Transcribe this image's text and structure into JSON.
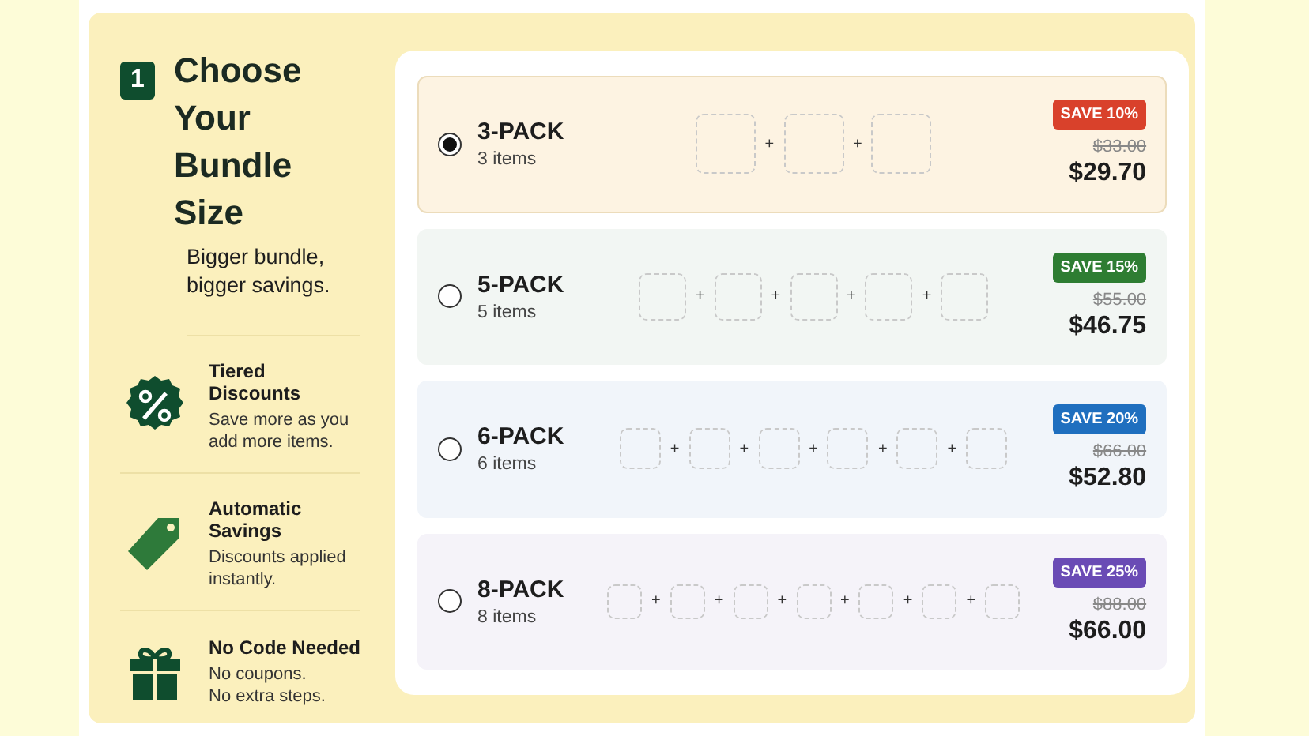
{
  "step": {
    "number": "1",
    "title": "Choose Your Bundle Size",
    "subtitle": "Bigger bundle, bigger savings."
  },
  "features": [
    {
      "kind": "percent",
      "title": "Tiered Discounts",
      "lines": [
        "Save more as you",
        "add more items."
      ]
    },
    {
      "kind": "tag",
      "title": "Automatic Savings",
      "lines": [
        "Discounts applied",
        "instantly."
      ]
    },
    {
      "kind": "gift",
      "title": "No Code Needed",
      "lines": [
        "No coupons.",
        "No extra steps."
      ]
    }
  ],
  "packs": [
    {
      "name": "3-PACK",
      "items": "3 items",
      "selected": true,
      "separators": [
        "+",
        "+"
      ],
      "badge": "SAVE 10%",
      "color": "#d9412b",
      "old_price": "$33.00",
      "price": "$29.70"
    },
    {
      "name": "5-PACK",
      "items": "5 items",
      "selected": false,
      "separators": [
        "+",
        "+",
        "+",
        "+"
      ],
      "badge": "SAVE 15%",
      "color": "#2e7d32",
      "old_price": "$55.00",
      "price": "$46.75"
    },
    {
      "name": "6-PACK",
      "items": "6 items",
      "selected": false,
      "separators": [
        "+",
        "+",
        "+",
        "+",
        "+"
      ],
      "badge": "SAVE 20%",
      "color": "#1f6fbf",
      "old_price": "$66.00",
      "price": "$52.80"
    },
    {
      "name": "8-PACK",
      "items": "8 items",
      "selected": false,
      "separators": [
        "+",
        "+",
        "+",
        "+",
        "+",
        "+"
      ],
      "badge": "SAVE 25%",
      "color": "#6a4bb5",
      "old_price": "$88.00",
      "price": "$66.00"
    }
  ]
}
